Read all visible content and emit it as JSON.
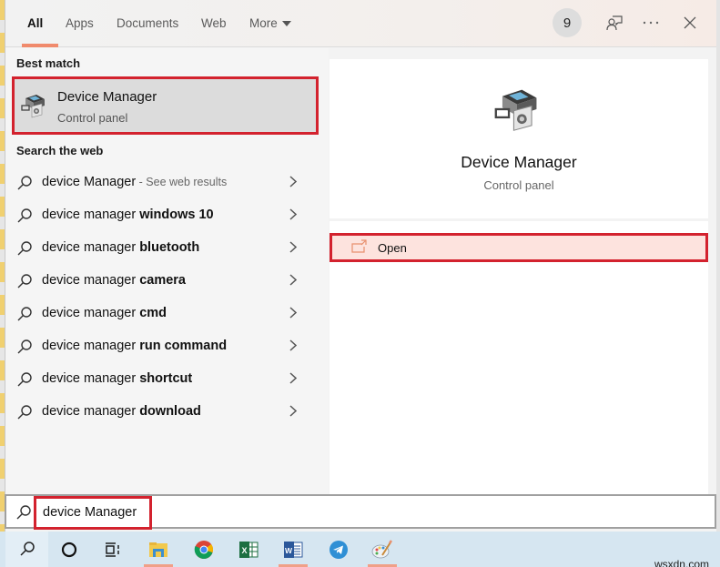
{
  "tabs": [
    {
      "label": "All",
      "active": true
    },
    {
      "label": "Apps",
      "active": false
    },
    {
      "label": "Documents",
      "active": false
    },
    {
      "label": "Web",
      "active": false
    },
    {
      "label": "More",
      "active": false
    }
  ],
  "header": {
    "badge_count": "9",
    "feedback_icon": "feedback-person-icon",
    "more_icon": "ellipsis-icon",
    "close_icon": "close-icon"
  },
  "best_match": {
    "section_label": "Best match",
    "title": "Device Manager",
    "subtitle": "Control panel",
    "icon": "device-manager-icon"
  },
  "web": {
    "section_label": "Search the web",
    "items": [
      {
        "prefix": "device Manager",
        "bold": "",
        "hint": " - See web results"
      },
      {
        "prefix": "device manager ",
        "bold": "windows 10",
        "hint": ""
      },
      {
        "prefix": "device manager ",
        "bold": "bluetooth",
        "hint": ""
      },
      {
        "prefix": "device manager ",
        "bold": "camera",
        "hint": ""
      },
      {
        "prefix": "device manager ",
        "bold": "cmd",
        "hint": ""
      },
      {
        "prefix": "device manager ",
        "bold": "run command",
        "hint": ""
      },
      {
        "prefix": "device manager ",
        "bold": "shortcut",
        "hint": ""
      },
      {
        "prefix": "device manager ",
        "bold": "download",
        "hint": ""
      }
    ]
  },
  "preview": {
    "title": "Device Manager",
    "subtitle": "Control panel",
    "open_label": "Open"
  },
  "search": {
    "value": "device Manager"
  },
  "taskbar": {
    "items": [
      {
        "name": "cortana-icon"
      },
      {
        "name": "task-view-icon"
      },
      {
        "name": "file-explorer-icon",
        "running": true
      },
      {
        "name": "chrome-icon"
      },
      {
        "name": "excel-icon"
      },
      {
        "name": "word-icon",
        "running": true
      },
      {
        "name": "telegram-icon"
      },
      {
        "name": "paint-icon",
        "running": true
      }
    ]
  },
  "watermark": "wsxdn.com",
  "colors": {
    "highlight_border": "#d3222e",
    "tab_accent": "#f08a6c",
    "open_bg": "#fde3de"
  }
}
